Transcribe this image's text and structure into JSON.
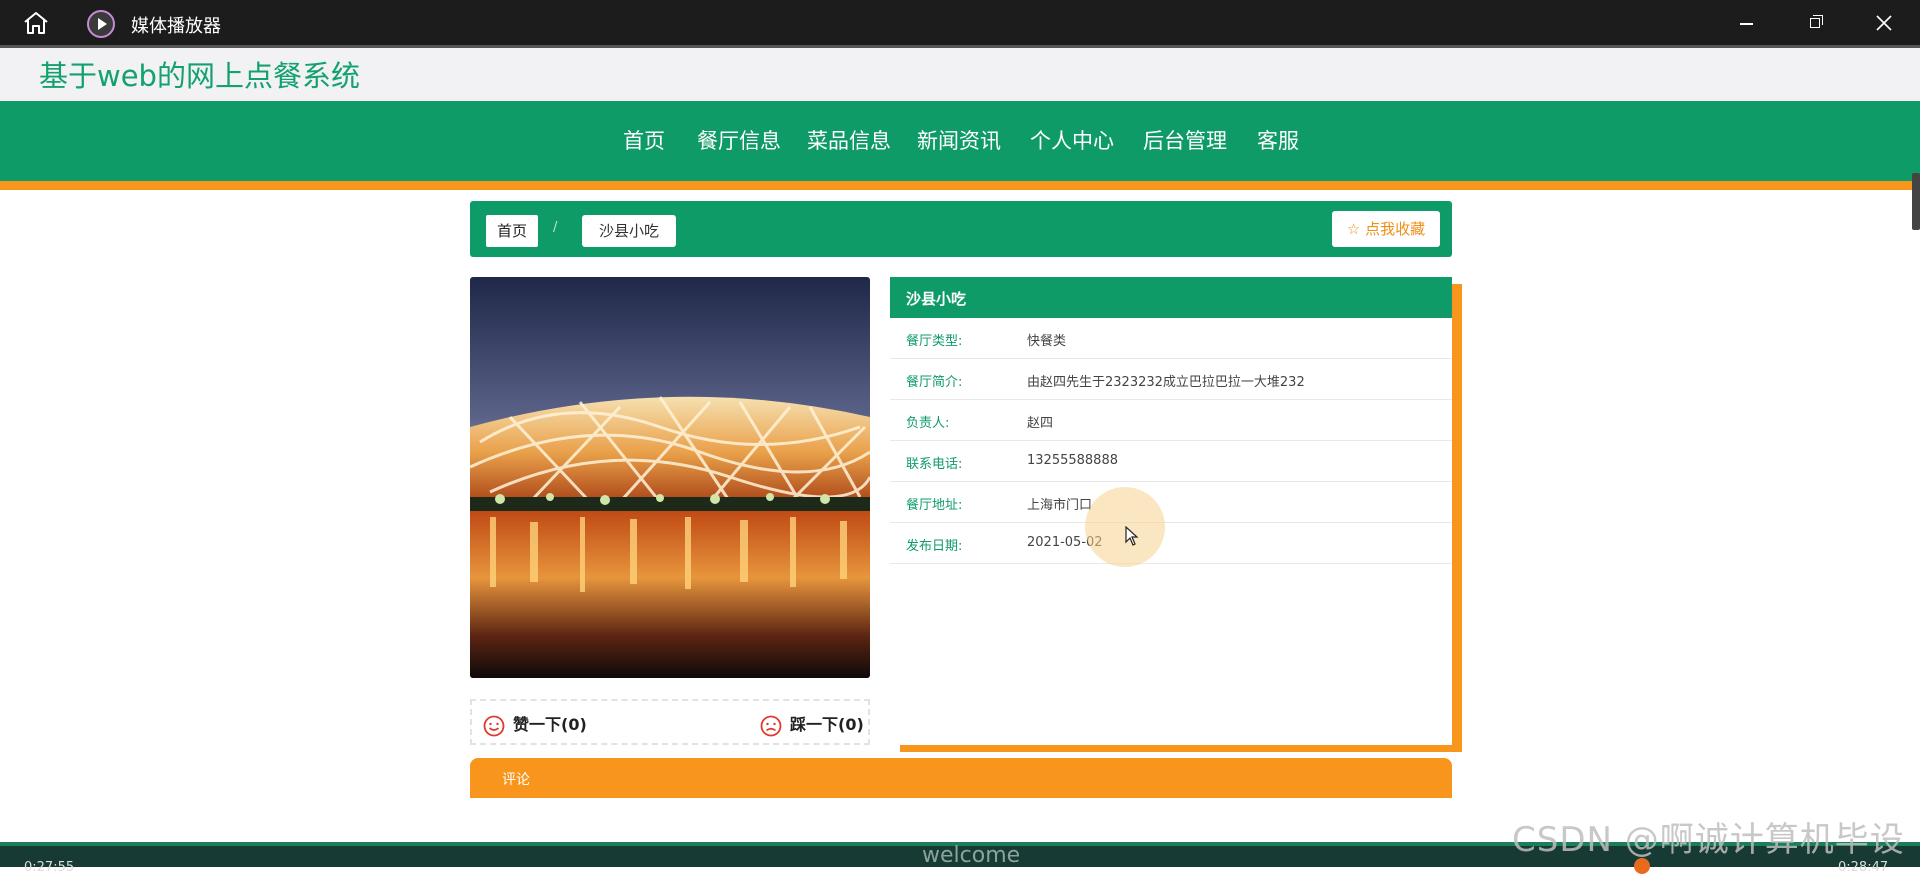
{
  "window": {
    "title": "媒体播放器"
  },
  "site": {
    "title": "基于web的网上点餐系统"
  },
  "nav": {
    "items": [
      "首页",
      "餐厅信息",
      "菜品信息",
      "新闻资讯",
      "个人中心",
      "后台管理",
      "客服"
    ]
  },
  "breadcrumb": {
    "home": "首页",
    "separator": "/",
    "current": "沙县小吃",
    "favorite": "☆ 点我收藏"
  },
  "votes": {
    "like": "赞一下(0)",
    "dislike": "踩一下(0)"
  },
  "restaurant": {
    "name": "沙县小吃",
    "fields": [
      {
        "label": "餐厅类型:",
        "value": "快餐类"
      },
      {
        "label": "餐厅简介:",
        "value": "由赵四先生于2323232成立巴拉巴拉一大堆232"
      },
      {
        "label": "负责人:",
        "value": "赵四"
      },
      {
        "label": "联系电话:",
        "value": "13255588888"
      },
      {
        "label": "餐厅地址:",
        "value": "上海市门口"
      },
      {
        "label": "发布日期:",
        "value": "2021-05-02"
      }
    ]
  },
  "comment": {
    "title": "评论"
  },
  "player": {
    "welcome": "welcome",
    "time_elapsed": "0:27:55",
    "time_total": "0:28:47"
  },
  "watermark": "CSDN @啊诚计算机毕设",
  "colors": {
    "brand_green": "#0f9b68",
    "accent_orange": "#f7951c",
    "title_green": "#13a16e"
  }
}
